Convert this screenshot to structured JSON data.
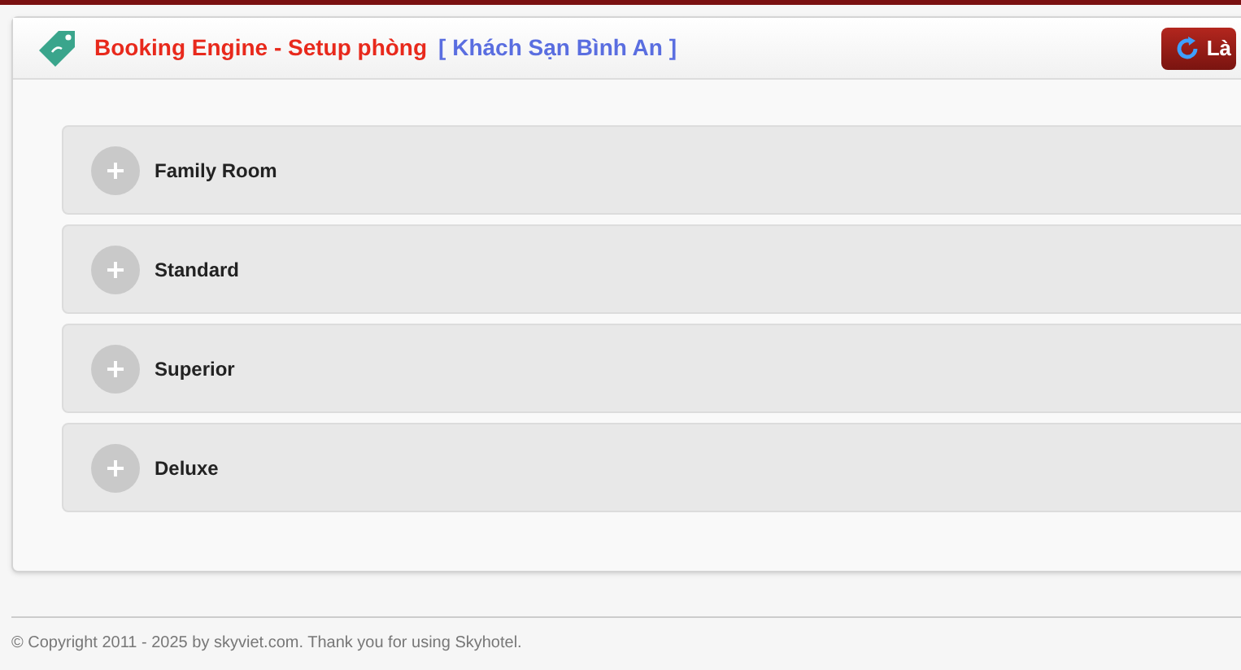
{
  "header": {
    "title": "Booking Engine - Setup phòng",
    "hotel": "[ Khách Sạn Bình An ]",
    "button": "Là"
  },
  "rooms": [
    {
      "name": "Family Room",
      "expanded": false
    },
    {
      "name": "Standard",
      "expanded": false
    },
    {
      "name": "Superior",
      "expanded": false
    },
    {
      "name": "Deluxe",
      "expanded": false
    }
  ],
  "footer": "© Copyright 2011 - 2025 by skyviet.com. Thank you for using Skyhotel."
}
